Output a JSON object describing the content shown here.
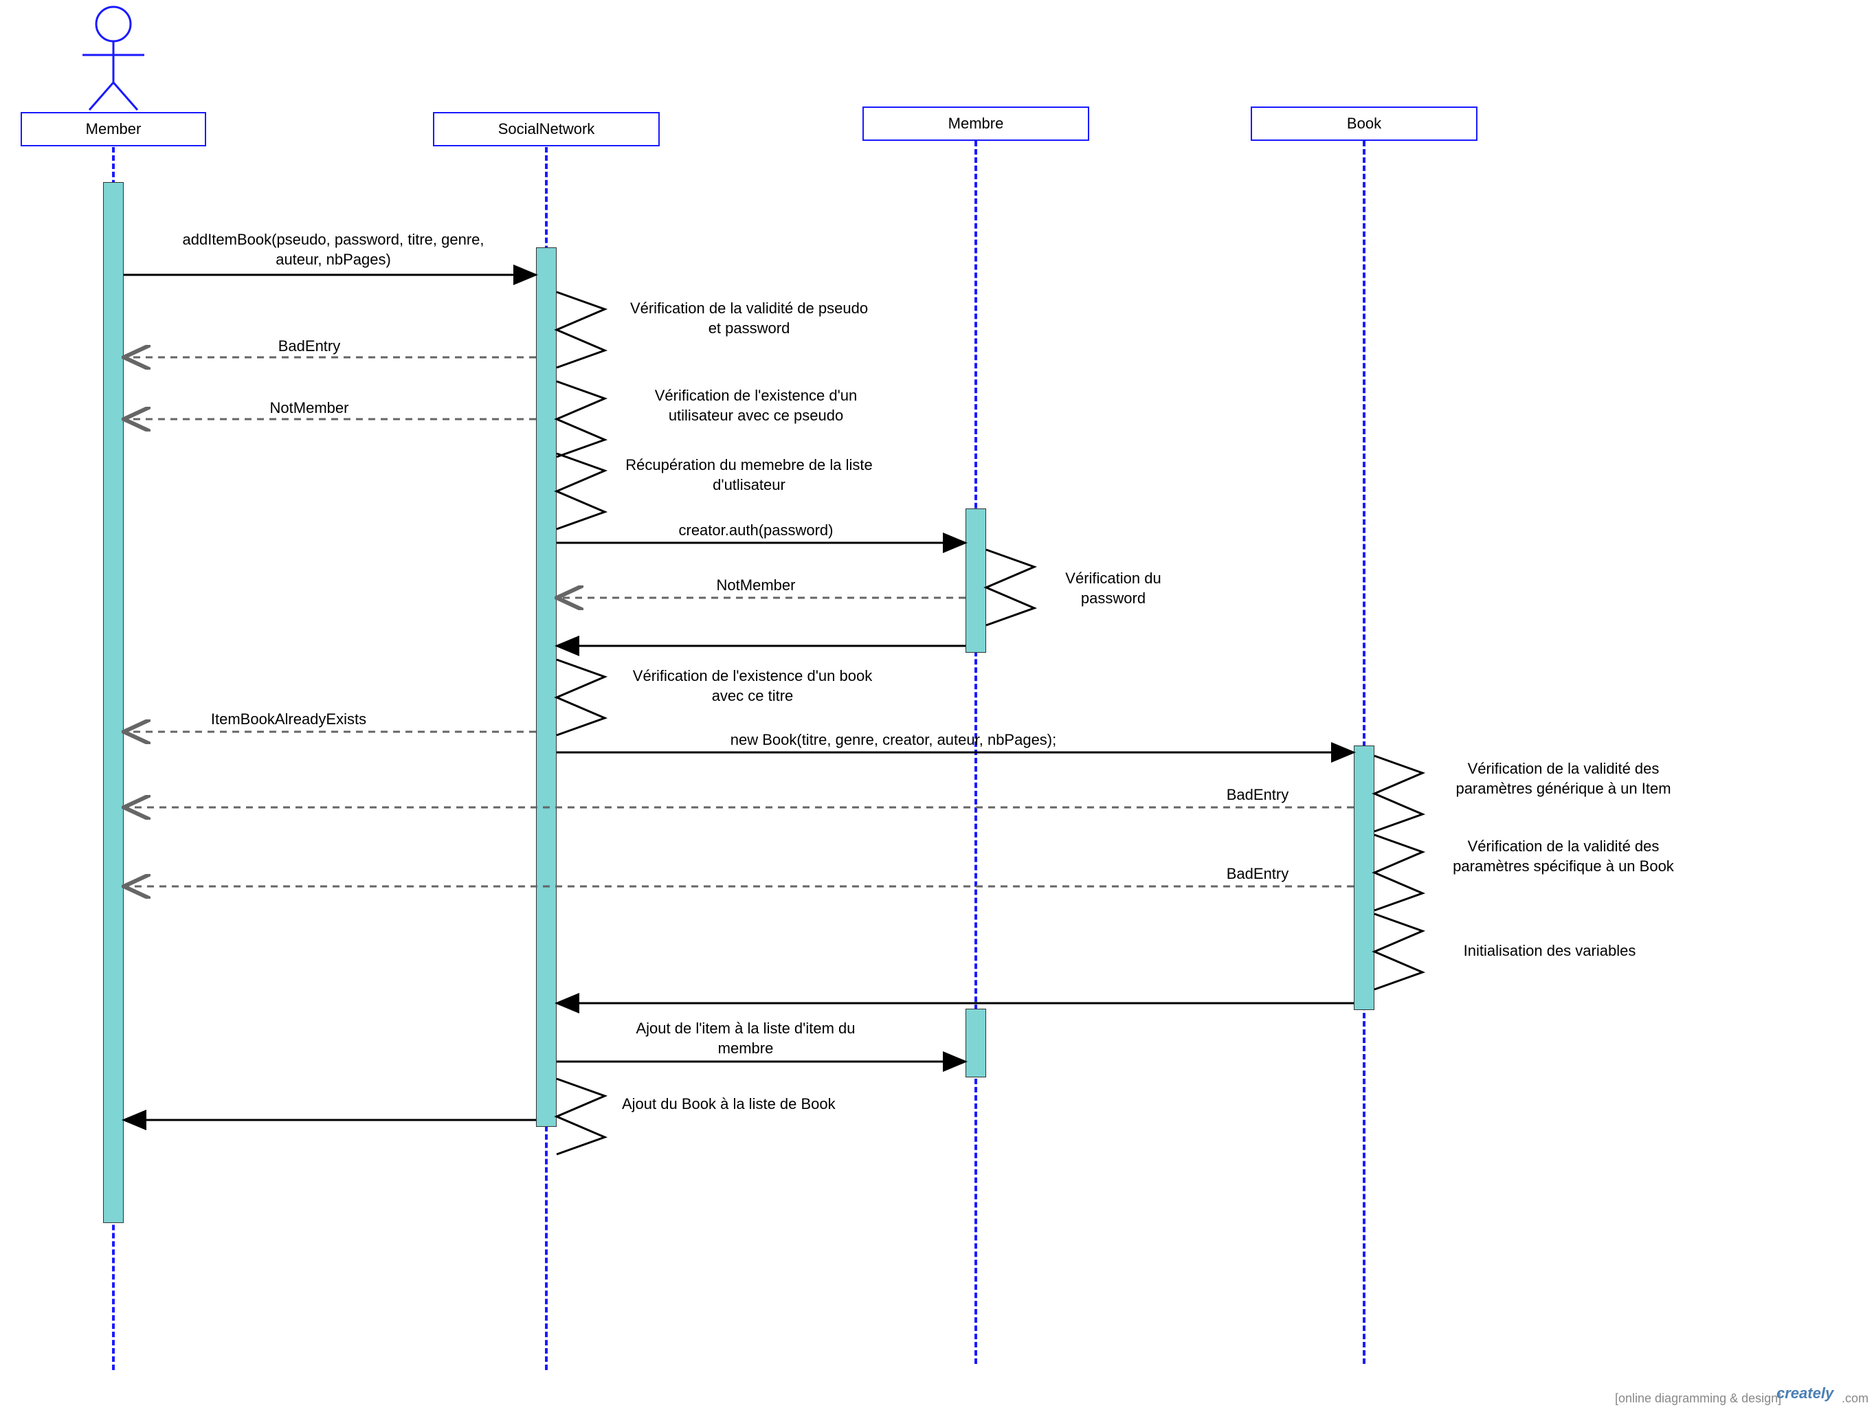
{
  "diagram_type": "UML Sequence Diagram",
  "actors": {
    "member": "Member",
    "socialnetwork": "SocialNetwork",
    "membre": "Membre",
    "book": "Book"
  },
  "messages": {
    "m1": "addItemBook(pseudo, password, titre, genre, auteur, nbPages)",
    "m2": "BadEntry",
    "m3": "NotMember",
    "m4": "creator.auth(password)",
    "m5": "NotMember",
    "m6": "ItemBookAlreadyExists",
    "m7": "new Book(titre, genre, creator, auteur, nbPages);",
    "m8": "BadEntry",
    "m9": "BadEntry",
    "m10": "Ajout de l'item à la liste d'item du membre"
  },
  "self_messages": {
    "s1": "Vérification de la validité de pseudo et password",
    "s2": "Vérification de l'existence d'un utilisateur avec ce pseudo",
    "s3": "Récupération du memebre de la liste d'utlisateur",
    "s4": "Vérification du password",
    "s5": "Vérification de l'existence d'un book avec ce titre",
    "s6": "Vérification de la validité des paramètres générique à un Item",
    "s7": "Vérification de la validité des paramètres spécifique à un Book",
    "s8": "Initialisation des variables",
    "s9": "Ajout du Book à la liste de Book"
  },
  "footer": {
    "tagline": "[online diagramming & design]",
    "brand": "creately",
    "suffix": ".com"
  }
}
